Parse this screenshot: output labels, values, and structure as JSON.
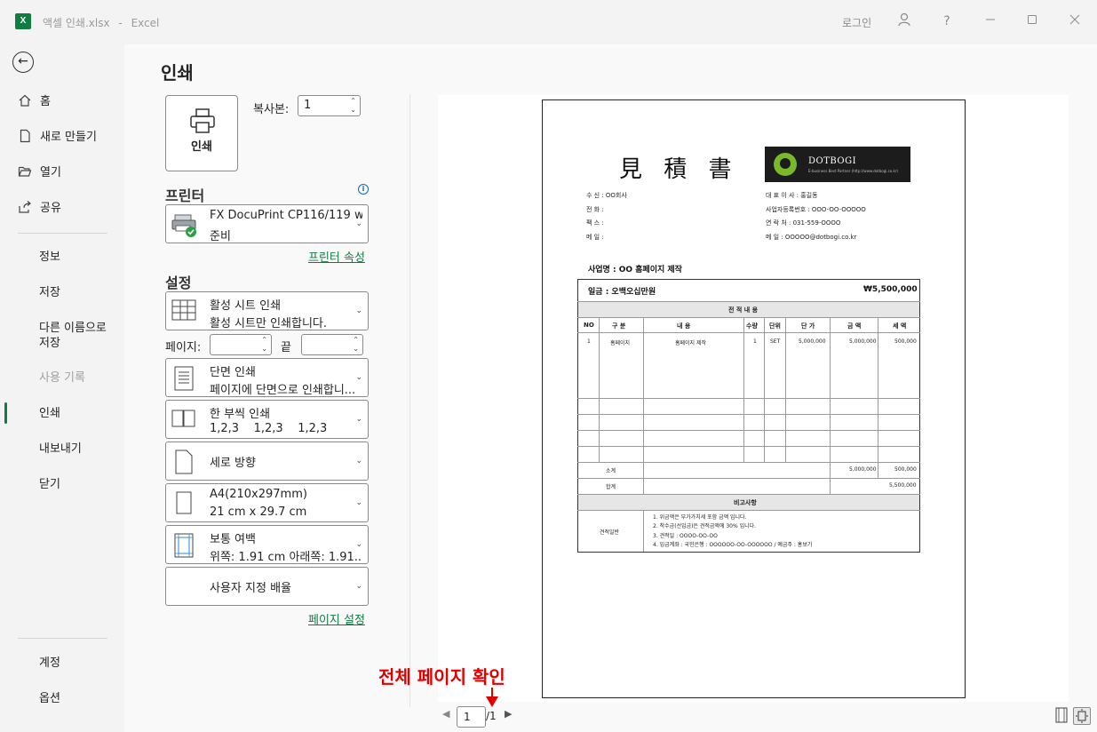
{
  "titlebar": {
    "app_icon": "excel-icon",
    "file_name": "액셀 인쇄.xlsx",
    "separator": "-",
    "app_name": "Excel",
    "login": "로그인",
    "icons": [
      "people-icon",
      "help-icon",
      "minimize-icon",
      "maximize-icon",
      "close-icon"
    ],
    "help_glyph": "?"
  },
  "nav": {
    "back_icon": "back-arrow-icon",
    "items": [
      {
        "label": "홈",
        "icon": "home-icon"
      },
      {
        "label": "새로 만들기",
        "icon": "new-file-icon"
      },
      {
        "label": "열기",
        "icon": "folder-open-icon"
      },
      {
        "label": "공유",
        "icon": "share-icon"
      },
      {
        "label": "정보"
      },
      {
        "label": "저장"
      },
      {
        "label": "다른 이름으로\n저장"
      },
      {
        "label": "사용 기록",
        "disabled": true
      },
      {
        "label": "인쇄",
        "selected": true
      },
      {
        "label": "내보내기"
      },
      {
        "label": "닫기"
      },
      {
        "label": "계정"
      },
      {
        "label": "옵션"
      }
    ]
  },
  "print": {
    "page_title": "인쇄",
    "print_button": "인쇄",
    "copies_label": "복사본:",
    "copies_value": "1",
    "printer_section": "프린터",
    "printer_name": "FX DocuPrint CP116/119 w...",
    "printer_status": "준비",
    "printer_properties": "프린터 속성",
    "settings_section": "설정",
    "settings": [
      {
        "line1": "활성 시트 인쇄",
        "line2": "활성 시트만 인쇄합니다.",
        "icon": "sheet-grid-icon"
      },
      {
        "line1": "단면 인쇄",
        "line2": "페이지에 단면으로 인쇄합니...",
        "icon": "one-sided-icon"
      },
      {
        "line1": "한 부씩 인쇄",
        "line2": "1,2,3    1,2,3    1,2,3",
        "icon": "collate-icon"
      },
      {
        "line1": "세로 방향",
        "line2": "",
        "icon": "portrait-icon"
      },
      {
        "line1": "A4(210x297mm)",
        "line2": "21 cm x 29.7 cm",
        "icon": "paper-size-icon"
      },
      {
        "line1": "보통 여백",
        "line2": "위쪽: 1.91 cm 아래쪽: 1.91...",
        "icon": "margins-icon"
      },
      {
        "line1": "사용자 지정 배율",
        "line2": "",
        "icon": "scaling-icon"
      }
    ],
    "pages_label": "페이지:",
    "pages_to_label": "끝",
    "page_setup": "페이지 설정"
  },
  "preview": {
    "doc_title": "見 積 書",
    "logo_name": "DOTBOGI",
    "logo_sub": "E-business Best Partner  (http://www.dotbogi.co.kr)",
    "recipient": [
      "수  신 : OO회사",
      "전  화 :",
      "팩  스 :",
      "메  일 :"
    ],
    "supplier": [
      "대  표  이  사 : 홍길동",
      "사업자등록번호 : OOO-OO-OOOOO",
      "연     락     처 : 031-559-OOOO",
      "메              일 : OOOOO@dotbogi.co.kr"
    ],
    "business_name": "사업명 : OO 홈페이지 제작",
    "amount_text": "일금 : 오백오십만원",
    "amount_value": "₩5,500,000",
    "section_header": "전 적 내 용",
    "columns": [
      "NO",
      "구  분",
      "내       용",
      "수량",
      "단위",
      "단 가",
      "금 액",
      "세 액"
    ],
    "row1": [
      "1",
      "홈페이지",
      "홈페이지 제작",
      "1",
      "SET",
      "5,000,000",
      "5,000,000",
      "500,000"
    ],
    "subtotal_label": "소계",
    "subtotal_amount": "5,000,000",
    "subtotal_tax": "500,000",
    "total_label": "합계",
    "total_value": "5,500,000",
    "remarks_header": "비고사항",
    "remarks_label": "견적일반",
    "remarks": [
      "1. 위금액은 부가가치세 포함 금액 입니다.",
      "2. 착수금(선입금)은 견적금액에 30% 입니다.",
      "3. 견적일 : OOOO-OO-OO",
      "4. 입금계좌 : 국민은행 : OOOOOO-OO-OOOOOO  / 예금주 : 홍보기"
    ]
  },
  "annotation": {
    "text": "전체 페이지 확인",
    "color": "#e00000"
  },
  "pager": {
    "current": "1",
    "total": "/1",
    "prev_icon": "prev-page-icon",
    "next_icon": "next-page-icon",
    "show_margins_icon": "show-margins-icon",
    "zoom_to_page_icon": "zoom-to-page-icon"
  },
  "colors": {
    "accent": "#107c41",
    "link": "#107c41",
    "info": "#0f6cbd"
  }
}
